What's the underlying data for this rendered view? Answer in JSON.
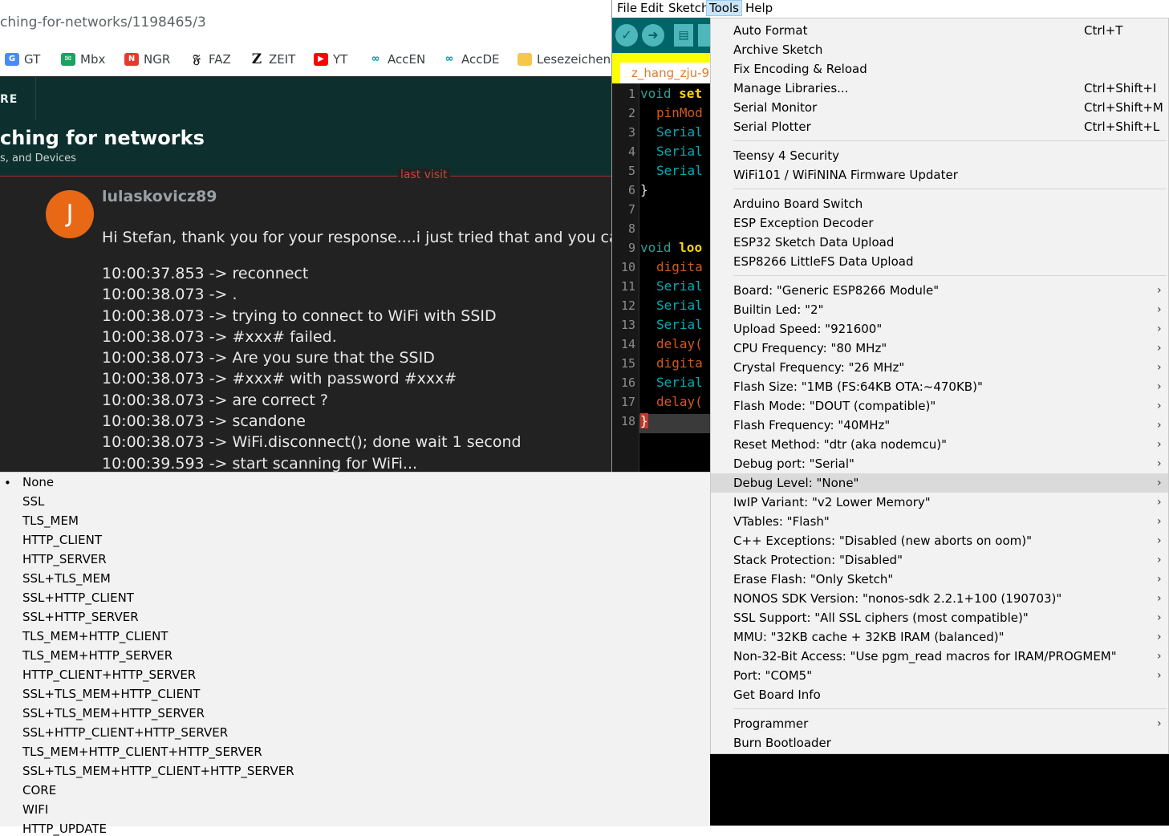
{
  "browser": {
    "url": "ching-for-networks/1198465/3",
    "bookmarks": [
      {
        "label": "GT",
        "icon": "google-translate-icon"
      },
      {
        "label": "Mbx",
        "icon": "mail-icon"
      },
      {
        "label": "NGR",
        "icon": "ngr-icon"
      },
      {
        "label": "FAZ",
        "icon": "faz-icon"
      },
      {
        "label": "ZEIT",
        "icon": "zeit-icon"
      },
      {
        "label": "YT",
        "icon": "youtube-icon"
      },
      {
        "label": "AccEN",
        "icon": "arduino-icon"
      },
      {
        "label": "AccDE",
        "icon": "arduino-icon"
      },
      {
        "label": "Lesezeichenle",
        "icon": "folder-icon"
      }
    ],
    "forum": {
      "nav_label": "RE",
      "topic_title": "ching for networks",
      "topic_category": "s, and Devices",
      "last_visit": "last visit",
      "avatar_letter": "J",
      "username": "lulaskovicz89",
      "post_text": "Hi Stefan, thank you for your response....i just tried that and you can see",
      "log_lines": [
        "10:00:37.853 -> reconnect",
        "10:00:38.073 -> .",
        "10:00:38.073 -> trying to connect to WiFi with SSID",
        "10:00:38.073 -> #xxx# failed.",
        "10:00:38.073 -> Are you sure that the SSID",
        "10:00:38.073 -> #xxx# with password #xxx#",
        "10:00:38.073 -> are correct ?",
        "10:00:38.073 -> scandone",
        "10:00:38.073 -> WiFi.disconnect(); done wait 1 second",
        "10:00:39.593 -> start scanning for WiFi..."
      ]
    }
  },
  "ide": {
    "menubar": [
      "File",
      "Edit",
      "Sketch",
      "Tools",
      "Help"
    ],
    "tab_label": "z_hang_zju-9",
    "line_numbers": [
      "1",
      "2",
      "3",
      "4",
      "5",
      "6",
      "7",
      "8",
      "9",
      "10",
      "11",
      "12",
      "13",
      "14",
      "15",
      "16",
      "17",
      "18"
    ],
    "code_lines": [
      {
        "kw": "void",
        "rest": "set"
      },
      {
        "rest": "pinMod"
      },
      {
        "rest": "Serial"
      },
      {
        "rest": "Serial"
      },
      {
        "rest": "Serial"
      },
      {
        "rest": "}"
      },
      {
        "rest": ""
      },
      {
        "rest": ""
      },
      {
        "kw": "void",
        "rest": "loo"
      },
      {
        "rest": "digita"
      },
      {
        "rest": "Serial"
      },
      {
        "rest": "Serial"
      },
      {
        "rest": "Serial"
      },
      {
        "rest": "delay("
      },
      {
        "rest": "digita"
      },
      {
        "rest": "Serial"
      },
      {
        "rest": "delay("
      },
      {
        "rest": "}"
      }
    ]
  },
  "tools_menu": {
    "items": [
      {
        "label": "Auto Format",
        "shortcut": "Ctrl+T"
      },
      {
        "label": "Archive Sketch"
      },
      {
        "label": "Fix Encoding & Reload"
      },
      {
        "label": "Manage Libraries...",
        "shortcut": "Ctrl+Shift+I"
      },
      {
        "label": "Serial Monitor",
        "shortcut": "Ctrl+Shift+M"
      },
      {
        "label": "Serial Plotter",
        "shortcut": "Ctrl+Shift+L"
      },
      {
        "label": "Teensy 4 Security"
      },
      {
        "label": "WiFi101 / WiFiNINA Firmware Updater"
      },
      {
        "label": "Arduino Board Switch"
      },
      {
        "label": "ESP Exception Decoder"
      },
      {
        "label": "ESP32 Sketch Data Upload"
      },
      {
        "label": "ESP8266 LittleFS Data Upload"
      },
      {
        "label": "Board: \"Generic ESP8266 Module\"",
        "submenu": true
      },
      {
        "label": "Builtin Led: \"2\"",
        "submenu": true
      },
      {
        "label": "Upload Speed: \"921600\"",
        "submenu": true
      },
      {
        "label": "CPU Frequency: \"80 MHz\"",
        "submenu": true
      },
      {
        "label": "Crystal Frequency: \"26 MHz\"",
        "submenu": true
      },
      {
        "label": "Flash Size: \"1MB (FS:64KB OTA:~470KB)\"",
        "submenu": true
      },
      {
        "label": "Flash Mode: \"DOUT (compatible)\"",
        "submenu": true
      },
      {
        "label": "Flash Frequency: \"40MHz\"",
        "submenu": true
      },
      {
        "label": "Reset Method: \"dtr (aka nodemcu)\"",
        "submenu": true
      },
      {
        "label": "Debug port: \"Serial\"",
        "submenu": true
      },
      {
        "label": "Debug Level: \"None\"",
        "submenu": true,
        "highlighted": true
      },
      {
        "label": "IwIP Variant: \"v2 Lower Memory\"",
        "submenu": true
      },
      {
        "label": "VTables: \"Flash\"",
        "submenu": true
      },
      {
        "label": "C++ Exceptions: \"Disabled (new aborts on oom)\"",
        "submenu": true
      },
      {
        "label": "Stack Protection: \"Disabled\"",
        "submenu": true
      },
      {
        "label": "Erase Flash: \"Only Sketch\"",
        "submenu": true
      },
      {
        "label": "NONOS SDK Version: \"nonos-sdk 2.2.1+100 (190703)\"",
        "submenu": true
      },
      {
        "label": "SSL Support: \"All SSL ciphers (most compatible)\"",
        "submenu": true
      },
      {
        "label": "MMU: \"32KB cache + 32KB IRAM (balanced)\"",
        "submenu": true
      },
      {
        "label": "Non-32-Bit Access: \"Use pgm_read macros for IRAM/PROGMEM\"",
        "submenu": true
      },
      {
        "label": "Port: \"COM5\"",
        "submenu": true
      },
      {
        "label": "Get Board Info"
      },
      {
        "label": "Programmer",
        "submenu": true
      },
      {
        "label": "Burn Bootloader"
      }
    ]
  },
  "debug_level_submenu": {
    "selected": "None",
    "options": [
      "None",
      "SSL",
      "TLS_MEM",
      "HTTP_CLIENT",
      "HTTP_SERVER",
      "SSL+TLS_MEM",
      "SSL+HTTP_CLIENT",
      "SSL+HTTP_SERVER",
      "TLS_MEM+HTTP_CLIENT",
      "TLS_MEM+HTTP_SERVER",
      "HTTP_CLIENT+HTTP_SERVER",
      "SSL+TLS_MEM+HTTP_CLIENT",
      "SSL+TLS_MEM+HTTP_SERVER",
      "SSL+HTTP_CLIENT+HTTP_SERVER",
      "TLS_MEM+HTTP_CLIENT+HTTP_SERVER",
      "SSL+TLS_MEM+HTTP_CLIENT+HTTP_SERVER",
      "CORE",
      "WIFI",
      "HTTP_UPDATE"
    ]
  }
}
